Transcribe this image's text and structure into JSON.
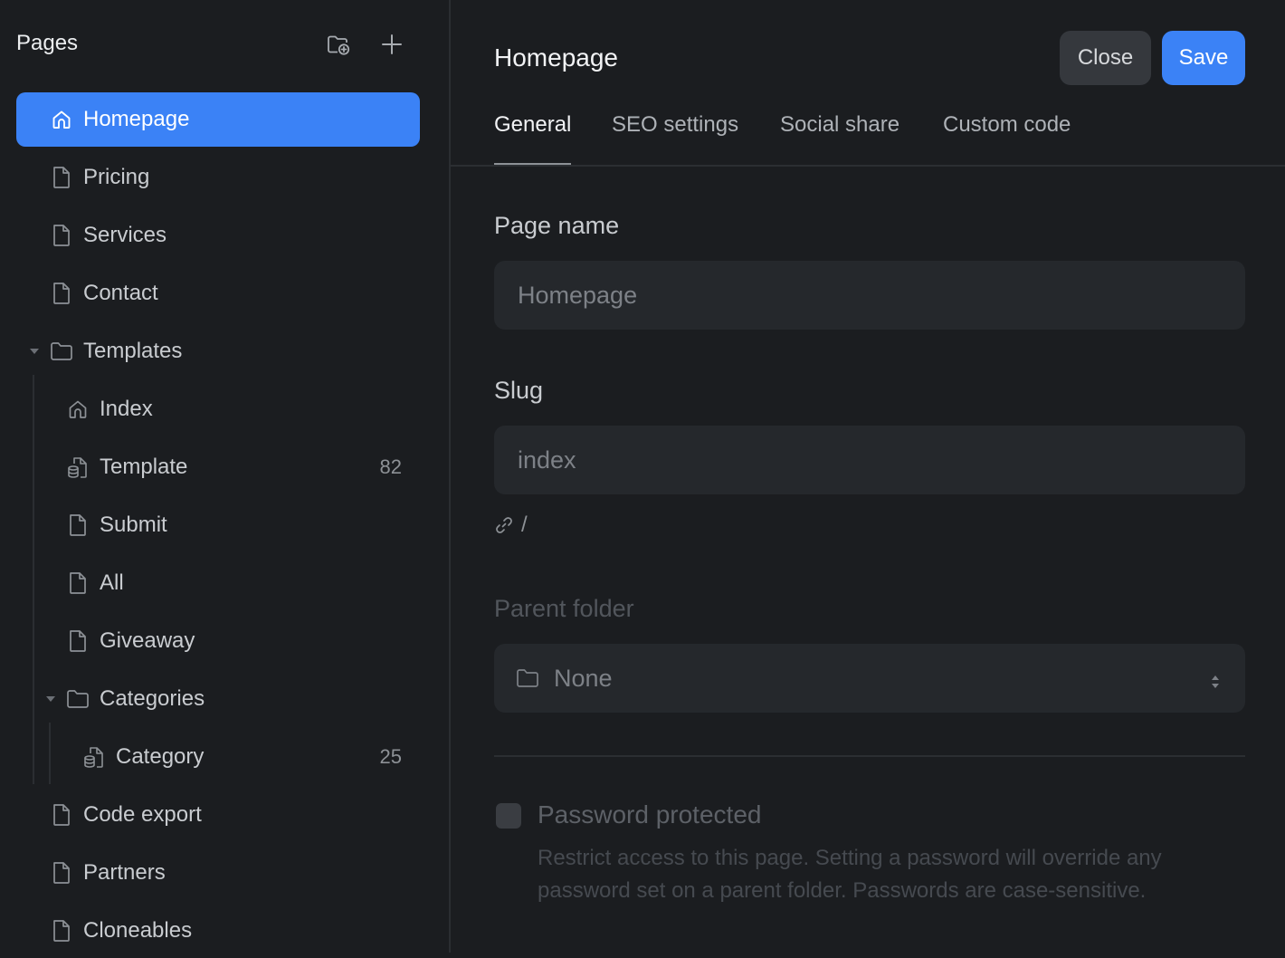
{
  "sidebar": {
    "title": "Pages",
    "new_folder_icon": "folder-plus-icon",
    "add_icon": "plus-icon",
    "items": [
      {
        "label": "Homepage",
        "icon": "home-icon"
      },
      {
        "label": "Pricing",
        "icon": "page-icon"
      },
      {
        "label": "Services",
        "icon": "page-icon"
      },
      {
        "label": "Contact",
        "icon": "page-icon"
      },
      {
        "label": "Templates",
        "icon": "folder-icon"
      },
      {
        "label": "Index",
        "icon": "home-icon"
      },
      {
        "label": "Template",
        "icon": "cms-page-icon",
        "count": "82"
      },
      {
        "label": "Submit",
        "icon": "page-icon"
      },
      {
        "label": "All",
        "icon": "page-icon"
      },
      {
        "label": "Giveaway",
        "icon": "page-icon"
      },
      {
        "label": "Categories",
        "icon": "folder-icon"
      },
      {
        "label": "Category",
        "icon": "cms-page-icon",
        "count": "25"
      },
      {
        "label": "Code export",
        "icon": "page-icon"
      },
      {
        "label": "Partners",
        "icon": "page-icon"
      },
      {
        "label": "Cloneables",
        "icon": "page-icon"
      }
    ]
  },
  "main": {
    "title": "Homepage",
    "close_label": "Close",
    "save_label": "Save",
    "tabs": [
      {
        "label": "General"
      },
      {
        "label": "SEO settings"
      },
      {
        "label": "Social share"
      },
      {
        "label": "Custom code"
      }
    ],
    "page_name": {
      "label": "Page name",
      "placeholder": "Homepage"
    },
    "slug": {
      "label": "Slug",
      "placeholder": "index",
      "path": "/"
    },
    "parent_folder": {
      "label": "Parent folder",
      "value": "None"
    },
    "password": {
      "label": "Password protected",
      "description": "Restrict access to this page. Setting a password will override any password set on a parent folder. Passwords are case-sensitive."
    }
  },
  "colors": {
    "accent": "#3b82f6",
    "background": "#1b1d20",
    "input_bg": "#25282c"
  }
}
